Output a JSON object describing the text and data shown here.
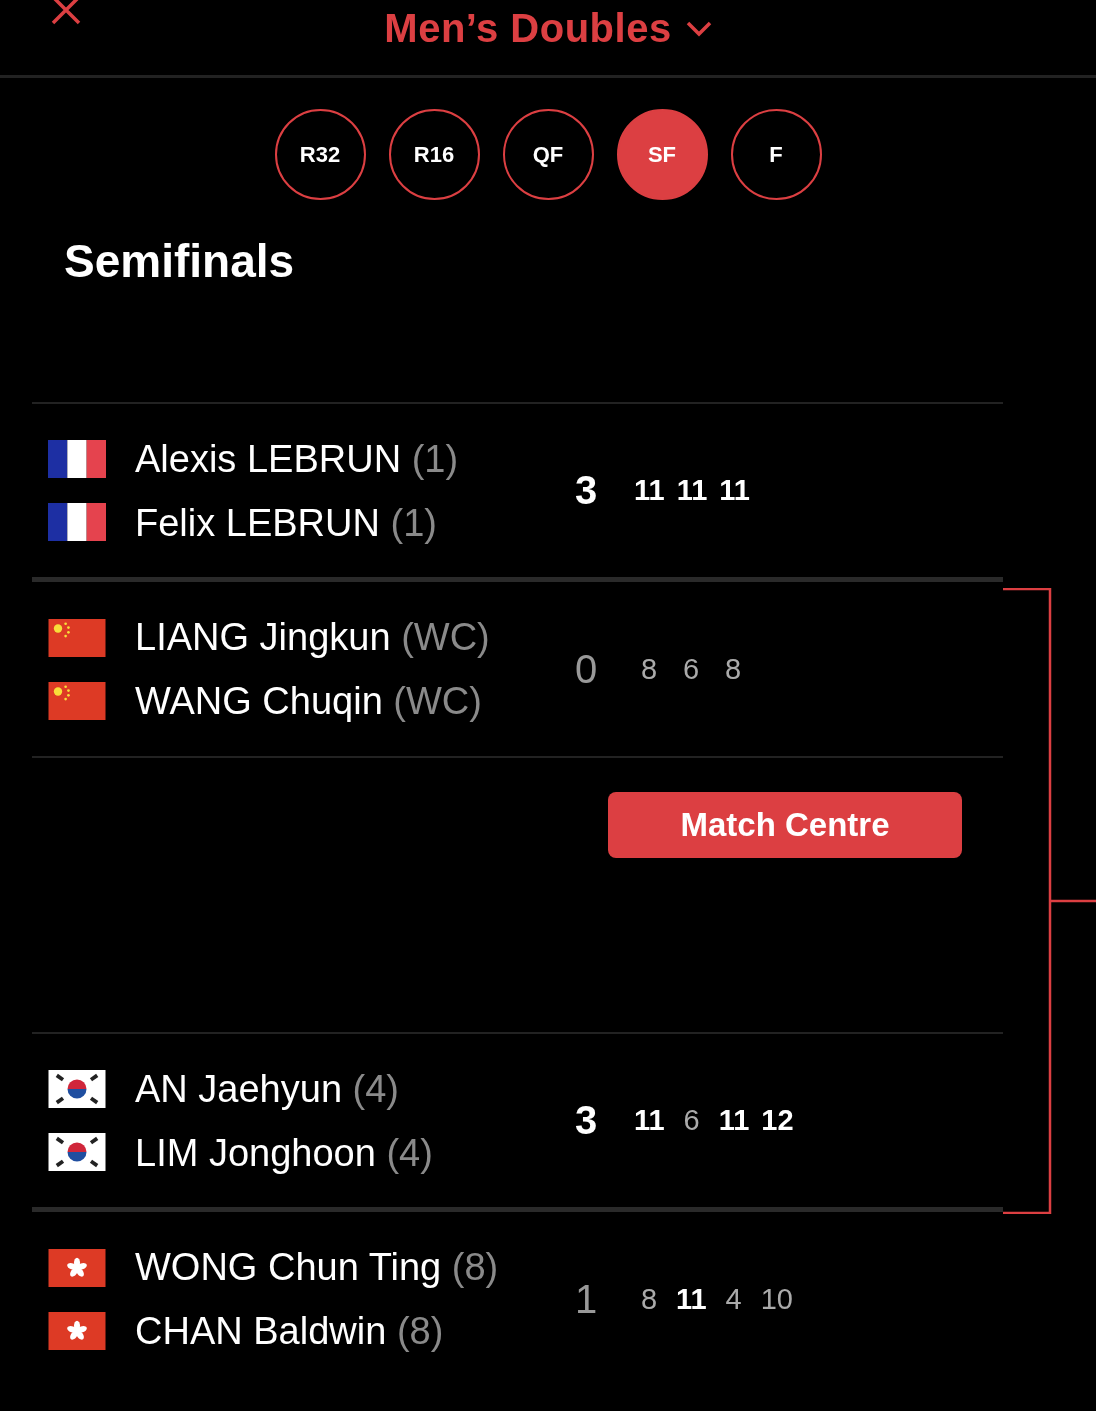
{
  "header": {
    "title": "Men’s Doubles"
  },
  "rounds": [
    {
      "label": "R32",
      "selected": false
    },
    {
      "label": "R16",
      "selected": false
    },
    {
      "label": "QF",
      "selected": false
    },
    {
      "label": "SF",
      "selected": true
    },
    {
      "label": "F",
      "selected": false
    }
  ],
  "section_title": "Semifinals",
  "matches": [
    {
      "teams": [
        {
          "kind": "fr",
          "players": [
            {
              "name": "Alexis LEBRUN",
              "seed": "(1)"
            },
            {
              "name": "Felix LEBRUN",
              "seed": "(1)"
            }
          ],
          "total": {
            "value": "3",
            "won": true
          },
          "games": [
            {
              "value": "11",
              "won": true
            },
            {
              "value": "11",
              "won": true
            },
            {
              "value": "11",
              "won": true
            }
          ]
        },
        {
          "kind": "cn",
          "players": [
            {
              "name": "LIANG Jingkun",
              "seed": "(WC)"
            },
            {
              "name": "WANG Chuqin",
              "seed": "(WC)"
            }
          ],
          "total": {
            "value": "0",
            "won": false
          },
          "games": [
            {
              "value": "8",
              "won": false
            },
            {
              "value": "6",
              "won": false
            },
            {
              "value": "8",
              "won": false
            }
          ]
        }
      ],
      "button": "Match Centre"
    },
    {
      "teams": [
        {
          "kind": "kr",
          "players": [
            {
              "name": "AN Jaehyun",
              "seed": "(4)"
            },
            {
              "name": "LIM Jonghoon",
              "seed": "(4)"
            }
          ],
          "total": {
            "value": "3",
            "won": true
          },
          "games": [
            {
              "value": "11",
              "won": true
            },
            {
              "value": "6",
              "won": false
            },
            {
              "value": "11",
              "won": true
            },
            {
              "value": "12",
              "won": true
            }
          ]
        },
        {
          "kind": "hk",
          "players": [
            {
              "name": "WONG Chun Ting",
              "seed": "(8)"
            },
            {
              "name": "CHAN Baldwin",
              "seed": "(8)"
            }
          ],
          "total": {
            "value": "1",
            "won": false
          },
          "games": [
            {
              "value": "8",
              "won": false
            },
            {
              "value": "11",
              "won": true
            },
            {
              "value": "4",
              "won": false
            },
            {
              "value": "10",
              "won": false
            }
          ]
        }
      ]
    }
  ]
}
